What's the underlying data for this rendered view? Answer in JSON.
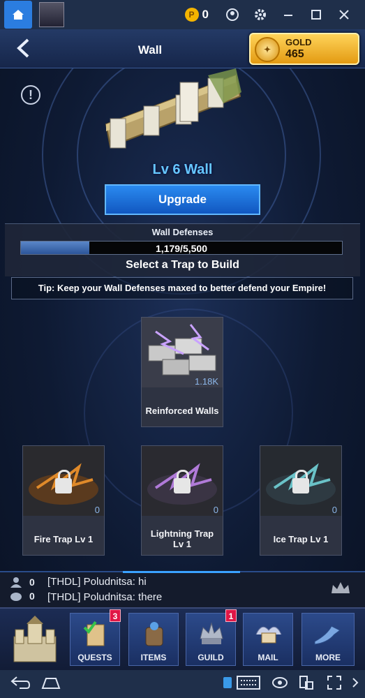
{
  "emulator": {
    "coin_count": "0",
    "app_thumb_label": "game"
  },
  "header": {
    "title": "Wall",
    "gold_label": "GOLD",
    "gold_value": "465"
  },
  "building": {
    "level_title": "Lv 6 Wall",
    "upgrade_label": "Upgrade"
  },
  "defenses": {
    "label": "Wall Defenses",
    "value_text": "1,179/5,500",
    "current": 1179,
    "max": 5500,
    "fill_fraction": 0.214,
    "select_title": "Select a Trap to Build"
  },
  "tip": "Tip: Keep your Wall Defenses maxed to better defend your Empire!",
  "traps": [
    {
      "name": "Reinforced Walls",
      "count": "1.18K",
      "locked": false
    },
    {
      "name": "Fire Trap Lv 1",
      "count": "0",
      "locked": true
    },
    {
      "name": "Lightning Trap Lv 1",
      "count": "0",
      "locked": true
    },
    {
      "name": "Ice Trap Lv 1",
      "count": "0",
      "locked": true
    }
  ],
  "chat": {
    "players_count": "0",
    "messages_count": "0",
    "lines": [
      "[THDL] Poludnitsa: hi",
      "[THDL] Poludnitsa: there"
    ]
  },
  "nav": {
    "items": [
      {
        "label": "",
        "badge": ""
      },
      {
        "label": "QUESTS",
        "badge": "3"
      },
      {
        "label": "ITEMS",
        "badge": ""
      },
      {
        "label": "GUILD",
        "badge": "1"
      },
      {
        "label": "MAIL",
        "badge": ""
      },
      {
        "label": "MORE",
        "badge": ""
      }
    ]
  },
  "colors": {
    "accent_blue": "#2a8af0",
    "level_text": "#66c7ff",
    "gold": "#ffd45a",
    "badge_red": "#e01646"
  }
}
